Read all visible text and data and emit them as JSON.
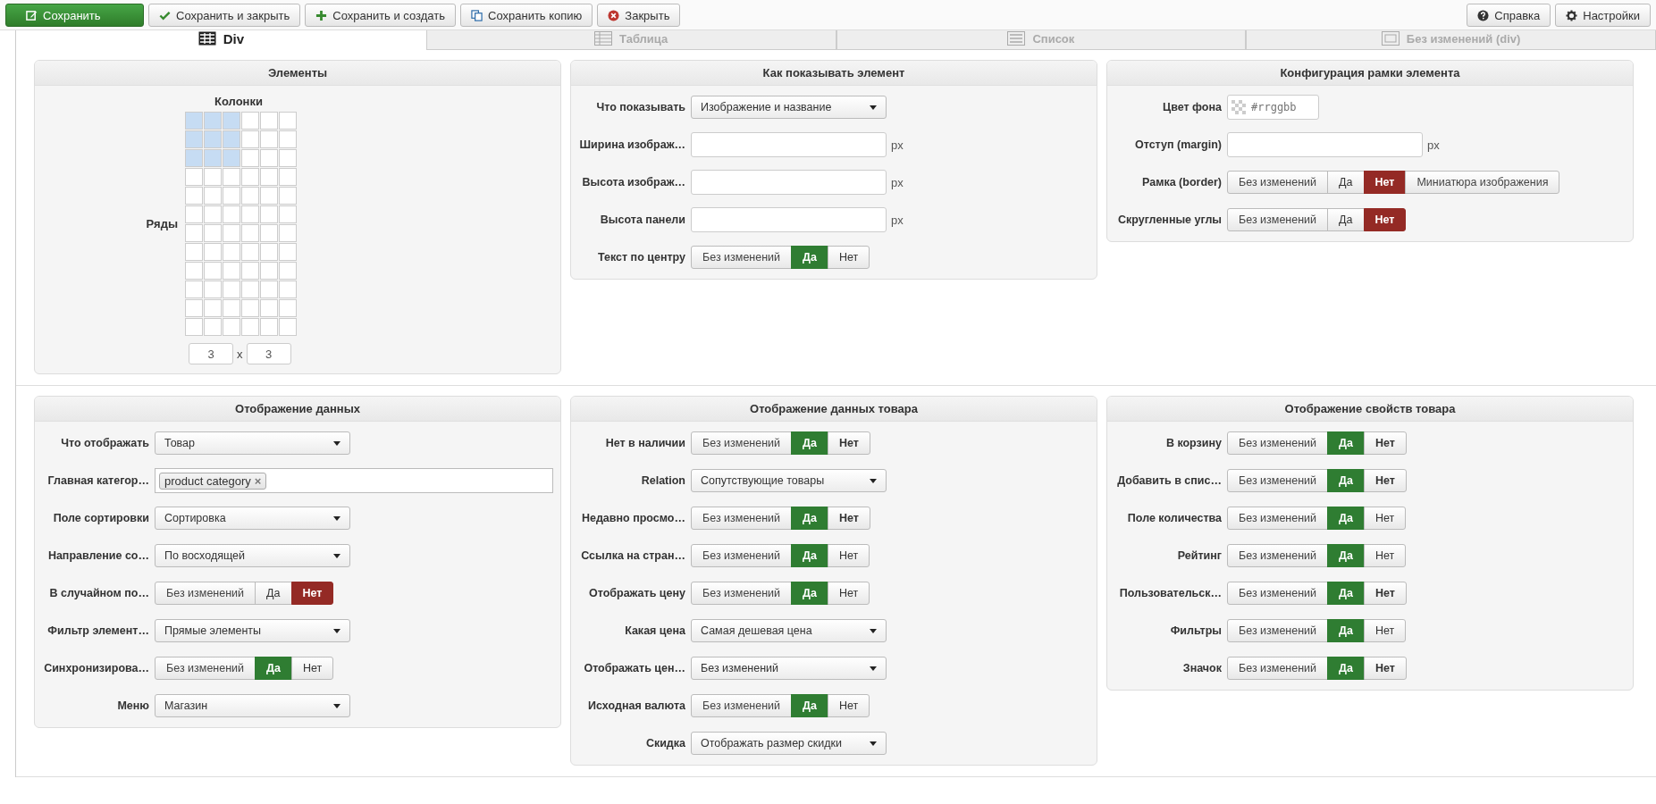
{
  "toolbar": {
    "left": [
      {
        "kind": "save",
        "label": "Сохранить"
      },
      {
        "kind": "check",
        "label": "Сохранить и закрыть"
      },
      {
        "kind": "plus",
        "label": "Сохранить и создать"
      },
      {
        "kind": "copy",
        "label": "Сохранить копию"
      },
      {
        "kind": "close",
        "label": "Закрыть"
      }
    ],
    "right": [
      {
        "kind": "help",
        "label": "Справка"
      },
      {
        "kind": "gear",
        "label": "Настройки"
      }
    ]
  },
  "tabs": [
    {
      "kind": "div",
      "label": "Div",
      "selected": true
    },
    {
      "kind": "table",
      "label": "Таблица",
      "selected": false
    },
    {
      "kind": "list",
      "label": "Список",
      "selected": false
    },
    {
      "kind": "plain",
      "label": "Без изменений (div)",
      "selected": false
    }
  ],
  "sections": [
    {
      "panels": [
        {
          "title": "Элементы",
          "kind": "grid",
          "grid": {
            "columns_label": "Колонки",
            "rows_label": "Ряды",
            "cols_value": "3",
            "rows_value": "3",
            "separator": "x",
            "rows": [
              {
                "cells": [
                  {
                    "selected": true
                  },
                  {
                    "selected": true
                  },
                  {
                    "selected": true
                  },
                  {
                    "selected": false
                  },
                  {
                    "selected": false
                  },
                  {
                    "selected": false
                  }
                ]
              },
              {
                "cells": [
                  {
                    "selected": true
                  },
                  {
                    "selected": true
                  },
                  {
                    "selected": true
                  },
                  {
                    "selected": false
                  },
                  {
                    "selected": false
                  },
                  {
                    "selected": false
                  }
                ]
              },
              {
                "cells": [
                  {
                    "selected": true
                  },
                  {
                    "selected": true
                  },
                  {
                    "selected": true
                  },
                  {
                    "selected": false
                  },
                  {
                    "selected": false
                  },
                  {
                    "selected": false
                  }
                ]
              },
              {
                "cells": [
                  {
                    "selected": false
                  },
                  {
                    "selected": false
                  },
                  {
                    "selected": false
                  },
                  {
                    "selected": false
                  },
                  {
                    "selected": false
                  },
                  {
                    "selected": false
                  }
                ]
              },
              {
                "cells": [
                  {
                    "selected": false
                  },
                  {
                    "selected": false
                  },
                  {
                    "selected": false
                  },
                  {
                    "selected": false
                  },
                  {
                    "selected": false
                  },
                  {
                    "selected": false
                  }
                ]
              },
              {
                "cells": [
                  {
                    "selected": false
                  },
                  {
                    "selected": false
                  },
                  {
                    "selected": false
                  },
                  {
                    "selected": false
                  },
                  {
                    "selected": false
                  },
                  {
                    "selected": false
                  }
                ]
              },
              {
                "cells": [
                  {
                    "selected": false
                  },
                  {
                    "selected": false
                  },
                  {
                    "selected": false
                  },
                  {
                    "selected": false
                  },
                  {
                    "selected": false
                  },
                  {
                    "selected": false
                  }
                ]
              },
              {
                "cells": [
                  {
                    "selected": false
                  },
                  {
                    "selected": false
                  },
                  {
                    "selected": false
                  },
                  {
                    "selected": false
                  },
                  {
                    "selected": false
                  },
                  {
                    "selected": false
                  }
                ]
              },
              {
                "cells": [
                  {
                    "selected": false
                  },
                  {
                    "selected": false
                  },
                  {
                    "selected": false
                  },
                  {
                    "selected": false
                  },
                  {
                    "selected": false
                  },
                  {
                    "selected": false
                  }
                ]
              },
              {
                "cells": [
                  {
                    "selected": false
                  },
                  {
                    "selected": false
                  },
                  {
                    "selected": false
                  },
                  {
                    "selected": false
                  },
                  {
                    "selected": false
                  },
                  {
                    "selected": false
                  }
                ]
              },
              {
                "cells": [
                  {
                    "selected": false
                  },
                  {
                    "selected": false
                  },
                  {
                    "selected": false
                  },
                  {
                    "selected": false
                  },
                  {
                    "selected": false
                  },
                  {
                    "selected": false
                  }
                ]
              },
              {
                "cells": [
                  {
                    "selected": false
                  },
                  {
                    "selected": false
                  },
                  {
                    "selected": false
                  },
                  {
                    "selected": false
                  },
                  {
                    "selected": false
                  },
                  {
                    "selected": false
                  }
                ]
              }
            ]
          }
        },
        {
          "title": "Как показывать элемент",
          "kind": "form",
          "rows": [
            {
              "kind": "select",
              "label": "Что показывать",
              "value": "Изображение и название"
            },
            {
              "kind": "input",
              "label": "Ширина изображ…",
              "unit": "px"
            },
            {
              "kind": "input",
              "label": "Высота изображ…",
              "unit": "px"
            },
            {
              "kind": "input",
              "label": "Высота панели",
              "unit": "px"
            },
            {
              "kind": "toggle",
              "label": "Текст по центру",
              "options": [
                {
                  "kind": "default",
                  "label": "Без изменений",
                  "selected": false,
                  "strong": false
                },
                {
                  "kind": "yes",
                  "label": "Да",
                  "selected": true,
                  "strong": false
                },
                {
                  "kind": "no",
                  "label": "Нет",
                  "selected": false,
                  "strong": false
                }
              ]
            }
          ]
        },
        {
          "title": "Конфигурация рамки элемента",
          "kind": "form",
          "rows": [
            {
              "kind": "color",
              "label": "Цвет фона",
              "placeholder": "#rrggbb"
            },
            {
              "kind": "input",
              "label": "Отступ (margin)",
              "unit": "px"
            },
            {
              "kind": "toggle",
              "label": "Рамка (border)",
              "options": [
                {
                  "kind": "default",
                  "label": "Без изменений",
                  "selected": false,
                  "strong": false
                },
                {
                  "kind": "yes",
                  "label": "Да",
                  "selected": false,
                  "strong": false
                },
                {
                  "kind": "no",
                  "label": "Нет",
                  "selected": true,
                  "strong": false
                },
                {
                  "kind": "default",
                  "label": "Миниатюра изображения",
                  "selected": false,
                  "strong": false
                }
              ]
            },
            {
              "kind": "toggle",
              "label": "Скругленные углы",
              "options": [
                {
                  "kind": "default",
                  "label": "Без изменений",
                  "selected": false,
                  "strong": false
                },
                {
                  "kind": "yes",
                  "label": "Да",
                  "selected": false,
                  "strong": false
                },
                {
                  "kind": "no",
                  "label": "Нет",
                  "selected": true,
                  "strong": false
                }
              ]
            }
          ]
        }
      ]
    },
    {
      "panels": [
        {
          "title": "Отображение данных",
          "kind": "form",
          "rows": [
            {
              "kind": "select",
              "label": "Что отображать",
              "value": "Товар"
            },
            {
              "kind": "tags",
              "label": "Главная категор…",
              "tags": [
                "product category"
              ],
              "remove": "×"
            },
            {
              "kind": "select",
              "label": "Поле сортировки",
              "value": "Сортировка"
            },
            {
              "kind": "select",
              "label": "Направление со…",
              "value": "По восходящей"
            },
            {
              "kind": "toggle",
              "label": "В случайном по…",
              "options": [
                {
                  "kind": "default",
                  "label": "Без изменений",
                  "selected": false,
                  "strong": false
                },
                {
                  "kind": "yes",
                  "label": "Да",
                  "selected": false,
                  "strong": false
                },
                {
                  "kind": "no",
                  "label": "Нет",
                  "selected": true,
                  "strong": false
                }
              ]
            },
            {
              "kind": "select",
              "label": "Фильтр элемент…",
              "value": "Прямые элементы"
            },
            {
              "kind": "toggle",
              "label": "Синхронизирова…",
              "options": [
                {
                  "kind": "default",
                  "label": "Без изменений",
                  "selected": false,
                  "strong": false
                },
                {
                  "kind": "yes",
                  "label": "Да",
                  "selected": true,
                  "strong": false
                },
                {
                  "kind": "no",
                  "label": "Нет",
                  "selected": false,
                  "strong": false
                }
              ]
            },
            {
              "kind": "select",
              "label": "Меню",
              "value": "Магазин"
            }
          ]
        },
        {
          "title": "Отображение данных товара",
          "kind": "form",
          "rows": [
            {
              "kind": "toggle",
              "label": "Нет в наличии",
              "options": [
                {
                  "kind": "default",
                  "label": "Без изменений",
                  "selected": false,
                  "strong": false
                },
                {
                  "kind": "yes",
                  "label": "Да",
                  "selected": true,
                  "strong": false
                },
                {
                  "kind": "no",
                  "label": "Нет",
                  "selected": false,
                  "strong": true
                }
              ]
            },
            {
              "kind": "select",
              "label": "Relation",
              "value": "Сопутствующие товары"
            },
            {
              "kind": "toggle",
              "label": "Недавно просмо…",
              "options": [
                {
                  "kind": "default",
                  "label": "Без изменений",
                  "selected": false,
                  "strong": false
                },
                {
                  "kind": "yes",
                  "label": "Да",
                  "selected": true,
                  "strong": false
                },
                {
                  "kind": "no",
                  "label": "Нет",
                  "selected": false,
                  "strong": true
                }
              ]
            },
            {
              "kind": "toggle",
              "label": "Ссылка на стран…",
              "options": [
                {
                  "kind": "default",
                  "label": "Без изменений",
                  "selected": false,
                  "strong": false
                },
                {
                  "kind": "yes",
                  "label": "Да",
                  "selected": true,
                  "strong": false
                },
                {
                  "kind": "no",
                  "label": "Нет",
                  "selected": false,
                  "strong": false
                }
              ]
            },
            {
              "kind": "toggle",
              "label": "Отображать цену",
              "options": [
                {
                  "kind": "default",
                  "label": "Без изменений",
                  "selected": false,
                  "strong": false
                },
                {
                  "kind": "yes",
                  "label": "Да",
                  "selected": true,
                  "strong": false
                },
                {
                  "kind": "no",
                  "label": "Нет",
                  "selected": false,
                  "strong": false
                }
              ]
            },
            {
              "kind": "select",
              "label": "Какая цена",
              "value": "Самая дешевая цена"
            },
            {
              "kind": "select",
              "label": "Отображать цен…",
              "value": "Без изменений"
            },
            {
              "kind": "toggle",
              "label": "Исходная валюта",
              "options": [
                {
                  "kind": "default",
                  "label": "Без изменений",
                  "selected": false,
                  "strong": false
                },
                {
                  "kind": "yes",
                  "label": "Да",
                  "selected": true,
                  "strong": false
                },
                {
                  "kind": "no",
                  "label": "Нет",
                  "selected": false,
                  "strong": false
                }
              ]
            },
            {
              "kind": "select",
              "label": "Скидка",
              "value": "Отображать размер скидки"
            }
          ]
        },
        {
          "title": "Отображение свойств товара",
          "kind": "form",
          "rows": [
            {
              "kind": "toggle",
              "label": "В корзину",
              "options": [
                {
                  "kind": "default",
                  "label": "Без изменений",
                  "selected": false,
                  "strong": false
                },
                {
                  "kind": "yes",
                  "label": "Да",
                  "selected": true,
                  "strong": false
                },
                {
                  "kind": "no",
                  "label": "Нет",
                  "selected": false,
                  "strong": true
                }
              ]
            },
            {
              "kind": "toggle",
              "label": "Добавить в спис…",
              "options": [
                {
                  "kind": "default",
                  "label": "Без изменений",
                  "selected": false,
                  "strong": false
                },
                {
                  "kind": "yes",
                  "label": "Да",
                  "selected": true,
                  "strong": false
                },
                {
                  "kind": "no",
                  "label": "Нет",
                  "selected": false,
                  "strong": true
                }
              ]
            },
            {
              "kind": "toggle",
              "label": "Поле количества",
              "options": [
                {
                  "kind": "default",
                  "label": "Без изменений",
                  "selected": false,
                  "strong": false
                },
                {
                  "kind": "yes",
                  "label": "Да",
                  "selected": true,
                  "strong": false
                },
                {
                  "kind": "no",
                  "label": "Нет",
                  "selected": false,
                  "strong": false
                }
              ]
            },
            {
              "kind": "toggle",
              "label": "Рейтинг",
              "options": [
                {
                  "kind": "default",
                  "label": "Без изменений",
                  "selected": false,
                  "strong": false
                },
                {
                  "kind": "yes",
                  "label": "Да",
                  "selected": true,
                  "strong": false
                },
                {
                  "kind": "no",
                  "label": "Нет",
                  "selected": false,
                  "strong": false
                }
              ]
            },
            {
              "kind": "toggle",
              "label": "Пользовательск…",
              "options": [
                {
                  "kind": "default",
                  "label": "Без изменений",
                  "selected": false,
                  "strong": false
                },
                {
                  "kind": "yes",
                  "label": "Да",
                  "selected": true,
                  "strong": false
                },
                {
                  "kind": "no",
                  "label": "Нет",
                  "selected": false,
                  "strong": true
                }
              ]
            },
            {
              "kind": "toggle",
              "label": "Фильтры",
              "options": [
                {
                  "kind": "default",
                  "label": "Без изменений",
                  "selected": false,
                  "strong": false
                },
                {
                  "kind": "yes",
                  "label": "Да",
                  "selected": true,
                  "strong": false
                },
                {
                  "kind": "no",
                  "label": "Нет",
                  "selected": false,
                  "strong": false
                }
              ]
            },
            {
              "kind": "toggle",
              "label": "Значок",
              "options": [
                {
                  "kind": "default",
                  "label": "Без изменений",
                  "selected": false,
                  "strong": false
                },
                {
                  "kind": "yes",
                  "label": "Да",
                  "selected": true,
                  "strong": false
                },
                {
                  "kind": "no",
                  "label": "Нет",
                  "selected": false,
                  "strong": true
                }
              ]
            }
          ]
        }
      ]
    }
  ]
}
